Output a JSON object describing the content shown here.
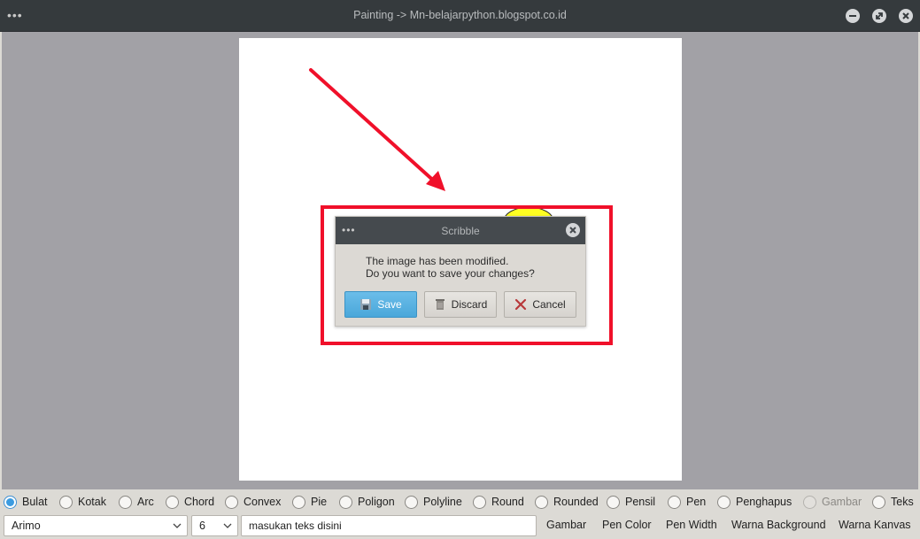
{
  "window": {
    "title": "Painting -> Mn-belajarpython.blogspot.co.id",
    "menu_glyph": "•••"
  },
  "dialog": {
    "title": "Scribble",
    "menu_glyph": "•••",
    "message_line1": "The image has been modified.",
    "message_line2": "Do you want to save your changes?",
    "buttons": {
      "save": "Save",
      "discard": "Discard",
      "cancel": "Cancel"
    }
  },
  "shapes": [
    {
      "label": "Bulat",
      "checked": true
    },
    {
      "label": "Kotak"
    },
    {
      "label": "Arc"
    },
    {
      "label": "Chord"
    },
    {
      "label": "Convex"
    },
    {
      "label": "Pie"
    },
    {
      "label": "Poligon"
    },
    {
      "label": "Polyline"
    },
    {
      "label": "Round"
    },
    {
      "label": "Rounded"
    },
    {
      "label": "Pensil"
    },
    {
      "label": "Pen"
    },
    {
      "label": "Penghapus"
    },
    {
      "label": "Gambar",
      "disabled": true
    },
    {
      "label": "Teks"
    }
  ],
  "controls": {
    "font_value": "Arimo",
    "size_value": "6",
    "text_value": "masukan teks disini",
    "gambar": "Gambar",
    "pen_color": "Pen Color",
    "pen_width": "Pen Width",
    "warna_background": "Warna Background",
    "warna_kanvas": "Warna Kanvas"
  },
  "colors": {
    "annotation": "#f0102a",
    "accent": "#3b9be0",
    "circle_fill": "#ffff22"
  }
}
